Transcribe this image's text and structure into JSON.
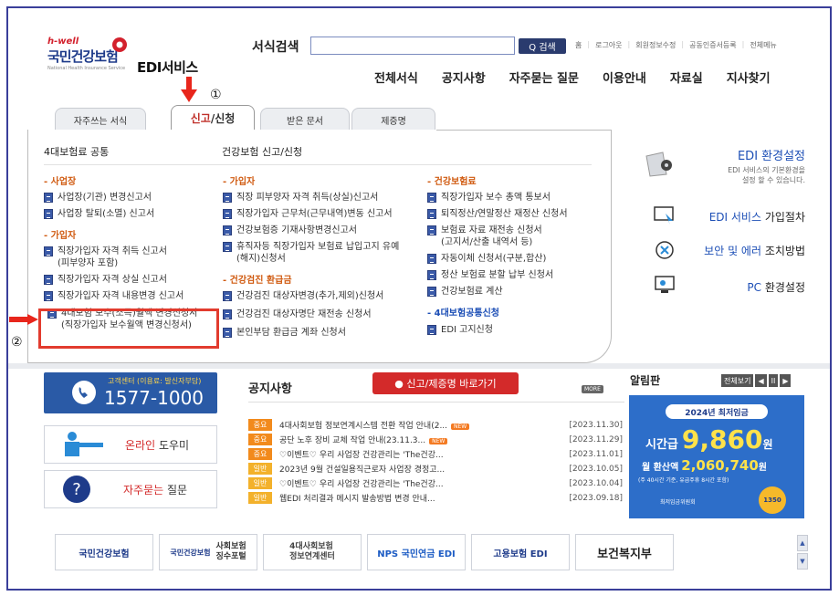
{
  "header": {
    "logo_hwell": "h-well",
    "logo_main": "국민건강보험",
    "logo_sub": "National Health Insurance Service",
    "service_title": "EDI서비스",
    "search_label": "서식검색",
    "search_button": "Q 검색",
    "top_links": [
      "홈",
      "로그아웃",
      "회원정보수정",
      "공동인증서등록",
      "전체메뉴"
    ],
    "gnb": [
      "전체서식",
      "공지사항",
      "자주묻는 질문",
      "이용안내",
      "자료실",
      "지사찾기"
    ]
  },
  "annotations": {
    "step1": "①",
    "step2": "②"
  },
  "tabs": {
    "t0": "자주쓰는 서식",
    "t1_a": "신고",
    "t1_b": "/신청",
    "t2": "받은 문서",
    "t3": "제증명"
  },
  "panel": {
    "col1_title": "4대보험료 공통",
    "col2_title": "건강보험 신고/신청",
    "col1": {
      "cat1": "- 사업장",
      "cat1_items": [
        "사업장(기관) 변경신고서",
        "사업장 탈퇴(소멸) 신고서"
      ],
      "cat2": "- 가입자",
      "cat2_items": [
        "직장가입자 자격 취득 신고서\n(피부양자 포함)",
        "직장가입자 자격 상실 신고서",
        "직장가입자 자격 내용변경 신고서",
        "4대보험 보수(소득)월액 변경신청서\n(직장가입자 보수월액 변경신청서)"
      ]
    },
    "col2": {
      "cat1": "- 가입자",
      "cat1_items": [
        "직장 피부양자 자격 취득(상실)신고서",
        "직장가입자 근무처(근무내역)변동 신고서",
        "건강보험증 기재사항변경신고서",
        "휴직자등 직장가입자 보험료 납입고지 유예\n(해지)신청서"
      ],
      "cat2": "- 건강검진 환급금",
      "cat2_items": [
        "건강검진 대상자변경(추가,제외)신청서",
        "건강검진 대상자명단 재전송 신청서",
        "본인부담 환급금 계좌 신청서"
      ]
    },
    "col3": {
      "cat1": "- 건강보험료",
      "cat1_items": [
        "직장가입자 보수 총액 통보서",
        "퇴직정산/연말정산 재정산 신청서",
        "보험료 자료 재전송 신청서\n(고지서/산출 내역서 등)",
        "자동이체 신청서(구분,합산)",
        "정산 보험료 분할 납부 신청서",
        "건강보험료 계산"
      ],
      "cat2": "- 4대보험공통신청",
      "cat2_items": [
        "EDI 고지신청"
      ]
    }
  },
  "right_menu": {
    "env_title": "EDI 환경설정",
    "env_desc": "EDI 서비스의 기본환경을\n설정 할 수 있습니다.",
    "join_a": "EDI 서비스 ",
    "join_b": "가입절차",
    "err_a": "보안 및 에러 ",
    "err_b": "조치방법",
    "pc_a": "PC ",
    "pc_b": "환경설정"
  },
  "left_panel": {
    "cc_label": "고객센터 (이용료: 발신자부담)",
    "cc_number": "1577-1000",
    "online_a": "온라인 ",
    "online_b": "도우미",
    "faq_a": "자주묻는 ",
    "faq_b": "질문"
  },
  "notice": {
    "title": "공지사항",
    "go_button": "● 신고/제증명 바로가기",
    "more": "MORE",
    "new_label": "NEW",
    "rows": [
      {
        "badge": "중요",
        "text": "4대사회보험 정보연계시스템 전환 작업 안내(2...",
        "new": true,
        "date": "[2023.11.30]"
      },
      {
        "badge": "중요",
        "text": "공단 노후 장비 교체 작업 안내(23.11.3...",
        "new": true,
        "date": "[2023.11.29]"
      },
      {
        "badge": "중요",
        "text": "♡이벤트♡ 우리 사업장 건강관리는 'The건강...",
        "new": false,
        "date": "[2023.11.01]"
      },
      {
        "badge": "일반",
        "text": "2023년 9월 건설일용직근로자 사업장 경정고...",
        "new": false,
        "date": "[2023.10.05]"
      },
      {
        "badge": "일반",
        "text": "♡이벤트♡ 우리 사업장 건강관리는 'The건강...",
        "new": false,
        "date": "[2023.10.04]"
      },
      {
        "badge": "일반",
        "text": "웹EDI 처리결과 메시지 발송방법 변경 안내...",
        "new": false,
        "date": "[2023.09.18]"
      }
    ],
    "badge_colors": {
      "중요": "#f28a1c",
      "일반": "#f3b12b"
    }
  },
  "alim": {
    "title": "알림판",
    "view_all": "전체보기",
    "prev": "◀",
    "pause": "II",
    "next": "▶",
    "banner_year": "2024년 최저임금",
    "banner_hour_label": "시간급",
    "banner_hour_value": "9,860",
    "banner_hour_unit": "원",
    "banner_month_label": "월 환산액",
    "banner_month_value": "2,060,740",
    "banner_month_unit": "원",
    "banner_note": "(주 40시간 기준, 유급주휴 8시간 포함)",
    "banner_org": "최저임금위원회",
    "banner_stamp": "1350"
  },
  "footer_logos": {
    "l1": "국민건강보험",
    "l2_a": "국민건강보험",
    "l2_b": "사회보험\n징수포털",
    "l3": "4대사회보험\n정보연계센터",
    "l4": "NPS 국민연금 EDI",
    "l5": "고용보험 EDI",
    "l6": "보건복지부",
    "up": "▲",
    "down": "▼"
  }
}
